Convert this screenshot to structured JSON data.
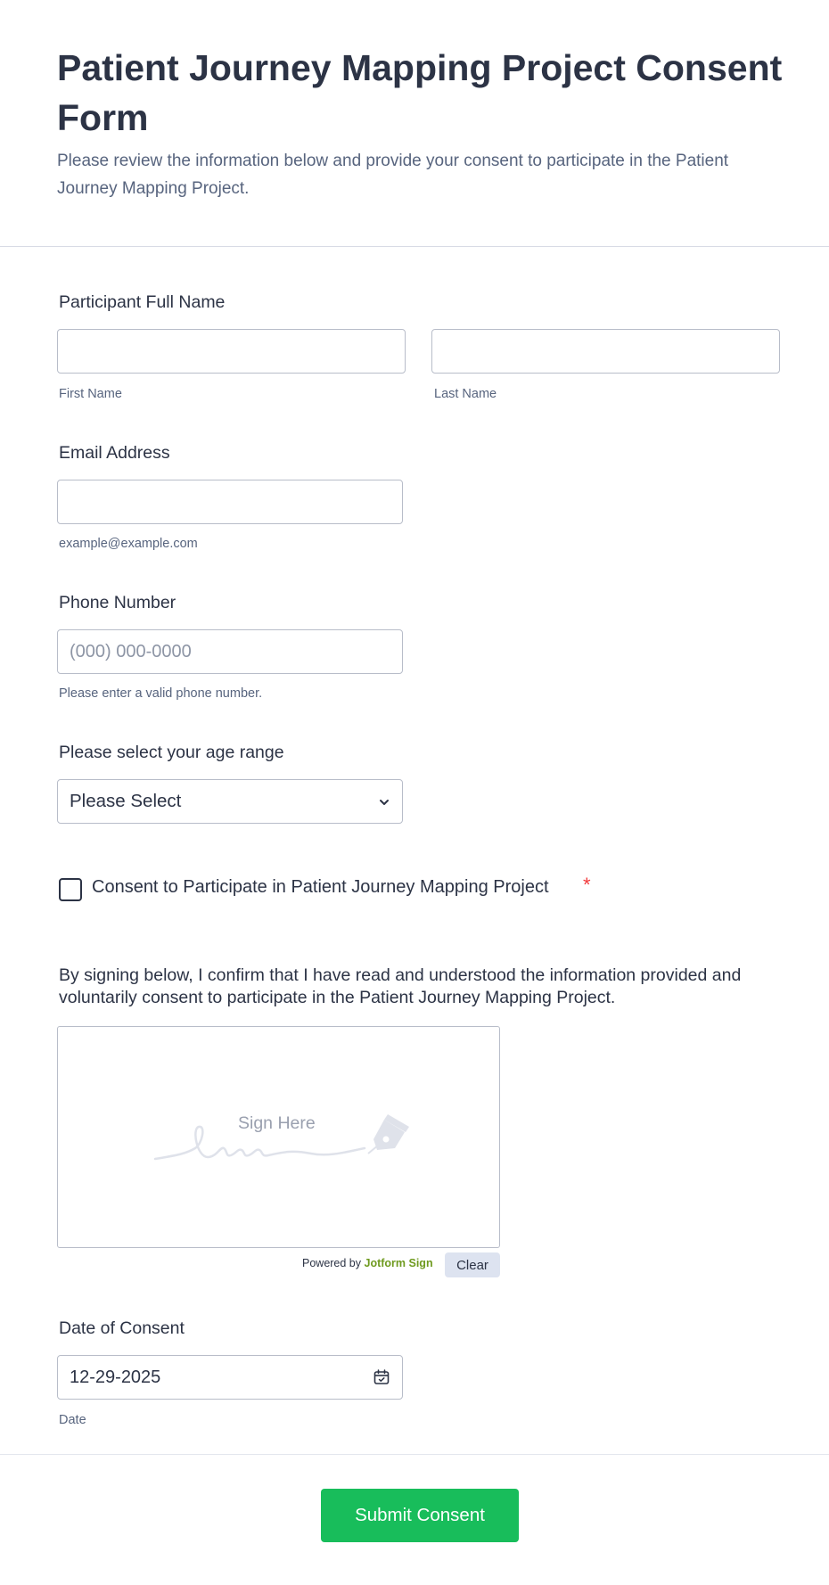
{
  "header": {
    "title": "Patient Journey Mapping Project Consent Form",
    "subtitle": "Please review the information below and provide your consent to participate in the Patient Journey Mapping Project."
  },
  "name_field": {
    "label": "Participant Full Name",
    "first_value": "",
    "last_value": "",
    "first_sublabel": "First Name",
    "last_sublabel": "Last Name"
  },
  "email_field": {
    "label": "Email Address",
    "value": "",
    "sublabel": "example@example.com"
  },
  "phone_field": {
    "label": "Phone Number",
    "placeholder": "(000) 000-0000",
    "sublabel": "Please enter a valid phone number."
  },
  "age_field": {
    "label": "Please select your age range",
    "selected": "Please Select",
    "icon": "chevron-down-icon"
  },
  "consent_checkbox": {
    "label": "Consent to Participate in Patient Journey Mapping Project",
    "required_mark": "*",
    "checked": false
  },
  "signature": {
    "label": "By signing below, I confirm that I have read and understood the information provided and voluntarily consent to participate in the Patient Journey Mapping Project.",
    "placeholder": "Sign Here",
    "powered_prefix": "Powered by",
    "powered_brand": "Jotform Sign",
    "clear_label": "Clear",
    "icon": "pen-nib-icon"
  },
  "date_field": {
    "label": "Date of Consent",
    "value": "12-29-2025",
    "sublabel": "Date",
    "icon": "calendar-icon"
  },
  "submit": {
    "label": "Submit Consent"
  },
  "colors": {
    "primary_text": "#2c3345",
    "secondary_text": "#57647e",
    "submit_bg": "#18bd5b",
    "required": "#f23a3c",
    "brand_green": "#6f9a1f"
  }
}
